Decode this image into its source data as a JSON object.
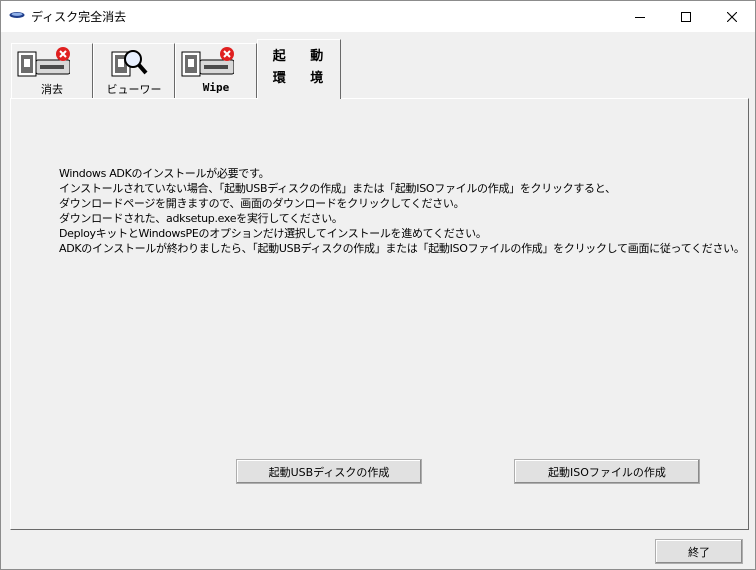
{
  "window": {
    "title": "ディスク完全消去",
    "icon": "disk-drive-icon"
  },
  "tabs": [
    {
      "label": "消去",
      "icon": "disk-erase-icon",
      "active": false
    },
    {
      "label": "ビューワー",
      "icon": "disk-magnifier-icon",
      "active": false
    },
    {
      "label": "Wipe",
      "icon": "disk-wipe-icon",
      "active": false
    },
    {
      "label_line1": "起 動",
      "label_line2": "環 境",
      "active": true
    }
  ],
  "info_lines": [
    "Windows ADKのインストールが必要です。",
    "インストールされていない場合、「起動USBディスクの作成」または「起動ISOファイルの作成」をクリックすると、",
    "ダウンロードページを開きますので、画面のダウンロードをクリックしてください。",
    "ダウンロードされた、adksetup.exeを実行してください。",
    "DeployキットとWindowsPEのオプションだけ選択してインストールを進めてください。",
    "ADKのインストールが終わりましたら、「起動USBディスクの作成」または「起動ISOファイルの作成」をクリックして画面に従ってください。"
  ],
  "buttons": {
    "usb": "起動USBディスクの作成",
    "iso": "起動ISOファイルの作成",
    "exit": "終了"
  }
}
